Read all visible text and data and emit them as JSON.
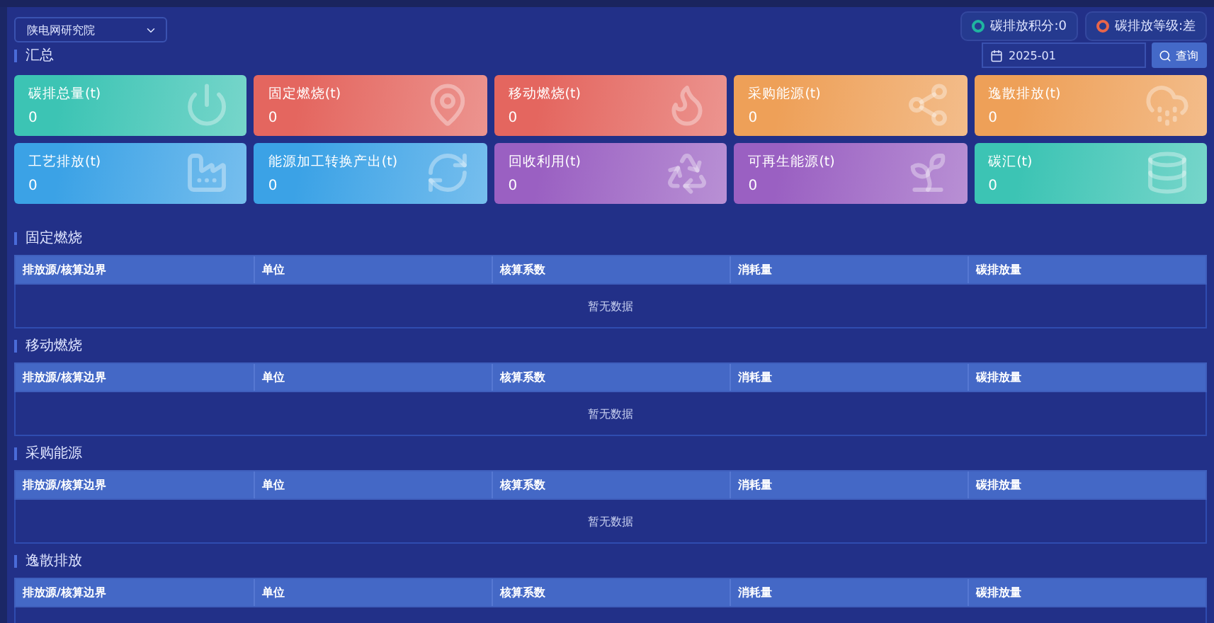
{
  "org_select": {
    "value": "陕电网研究院"
  },
  "badges": [
    {
      "label": "碳排放积分:0",
      "color": "#1fb5a0"
    },
    {
      "label": "碳排放等级:差",
      "color": "#e8654a"
    }
  ],
  "summary": {
    "title": "汇总",
    "date": "2025-01",
    "query_button": "查询"
  },
  "cards": [
    {
      "label": "碳排总量(t)",
      "value": "0",
      "color": "#3cc4b4"
    },
    {
      "label": "固定燃烧(t)",
      "value": "0",
      "color": "#e4665f"
    },
    {
      "label": "移动燃烧(t)",
      "value": "0",
      "color": "#e4665f"
    },
    {
      "label": "采购能源(t)",
      "value": "0",
      "color": "#eea058"
    },
    {
      "label": "逸散排放(t)",
      "value": "0",
      "color": "#eea058"
    },
    {
      "label": "工艺排放(t)",
      "value": "0",
      "color": "#3ba2e6"
    },
    {
      "label": "能源加工转换产出(t)",
      "value": "0",
      "color": "#3ba2e6"
    },
    {
      "label": "回收利用(t)",
      "value": "0",
      "color": "#9a60c2"
    },
    {
      "label": "可再生能源(t)",
      "value": "0",
      "color": "#9a60c2"
    },
    {
      "label": "碳汇(t)",
      "value": "0",
      "color": "#3cc4b4"
    }
  ],
  "sections": [
    {
      "title": "固定燃烧",
      "columns": [
        "排放源/核算边界",
        "单位",
        "核算系数",
        "消耗量",
        "碳排放量"
      ],
      "empty_text": "暂无数据"
    },
    {
      "title": "移动燃烧",
      "columns": [
        "排放源/核算边界",
        "单位",
        "核算系数",
        "消耗量",
        "碳排放量"
      ],
      "empty_text": "暂无数据"
    },
    {
      "title": "采购能源",
      "columns": [
        "排放源/核算边界",
        "单位",
        "核算系数",
        "消耗量",
        "碳排放量"
      ],
      "empty_text": "暂无数据"
    },
    {
      "title": "逸散排放",
      "columns": [
        "排放源/核算边界",
        "单位",
        "核算系数",
        "消耗量",
        "碳排放量"
      ]
    }
  ]
}
